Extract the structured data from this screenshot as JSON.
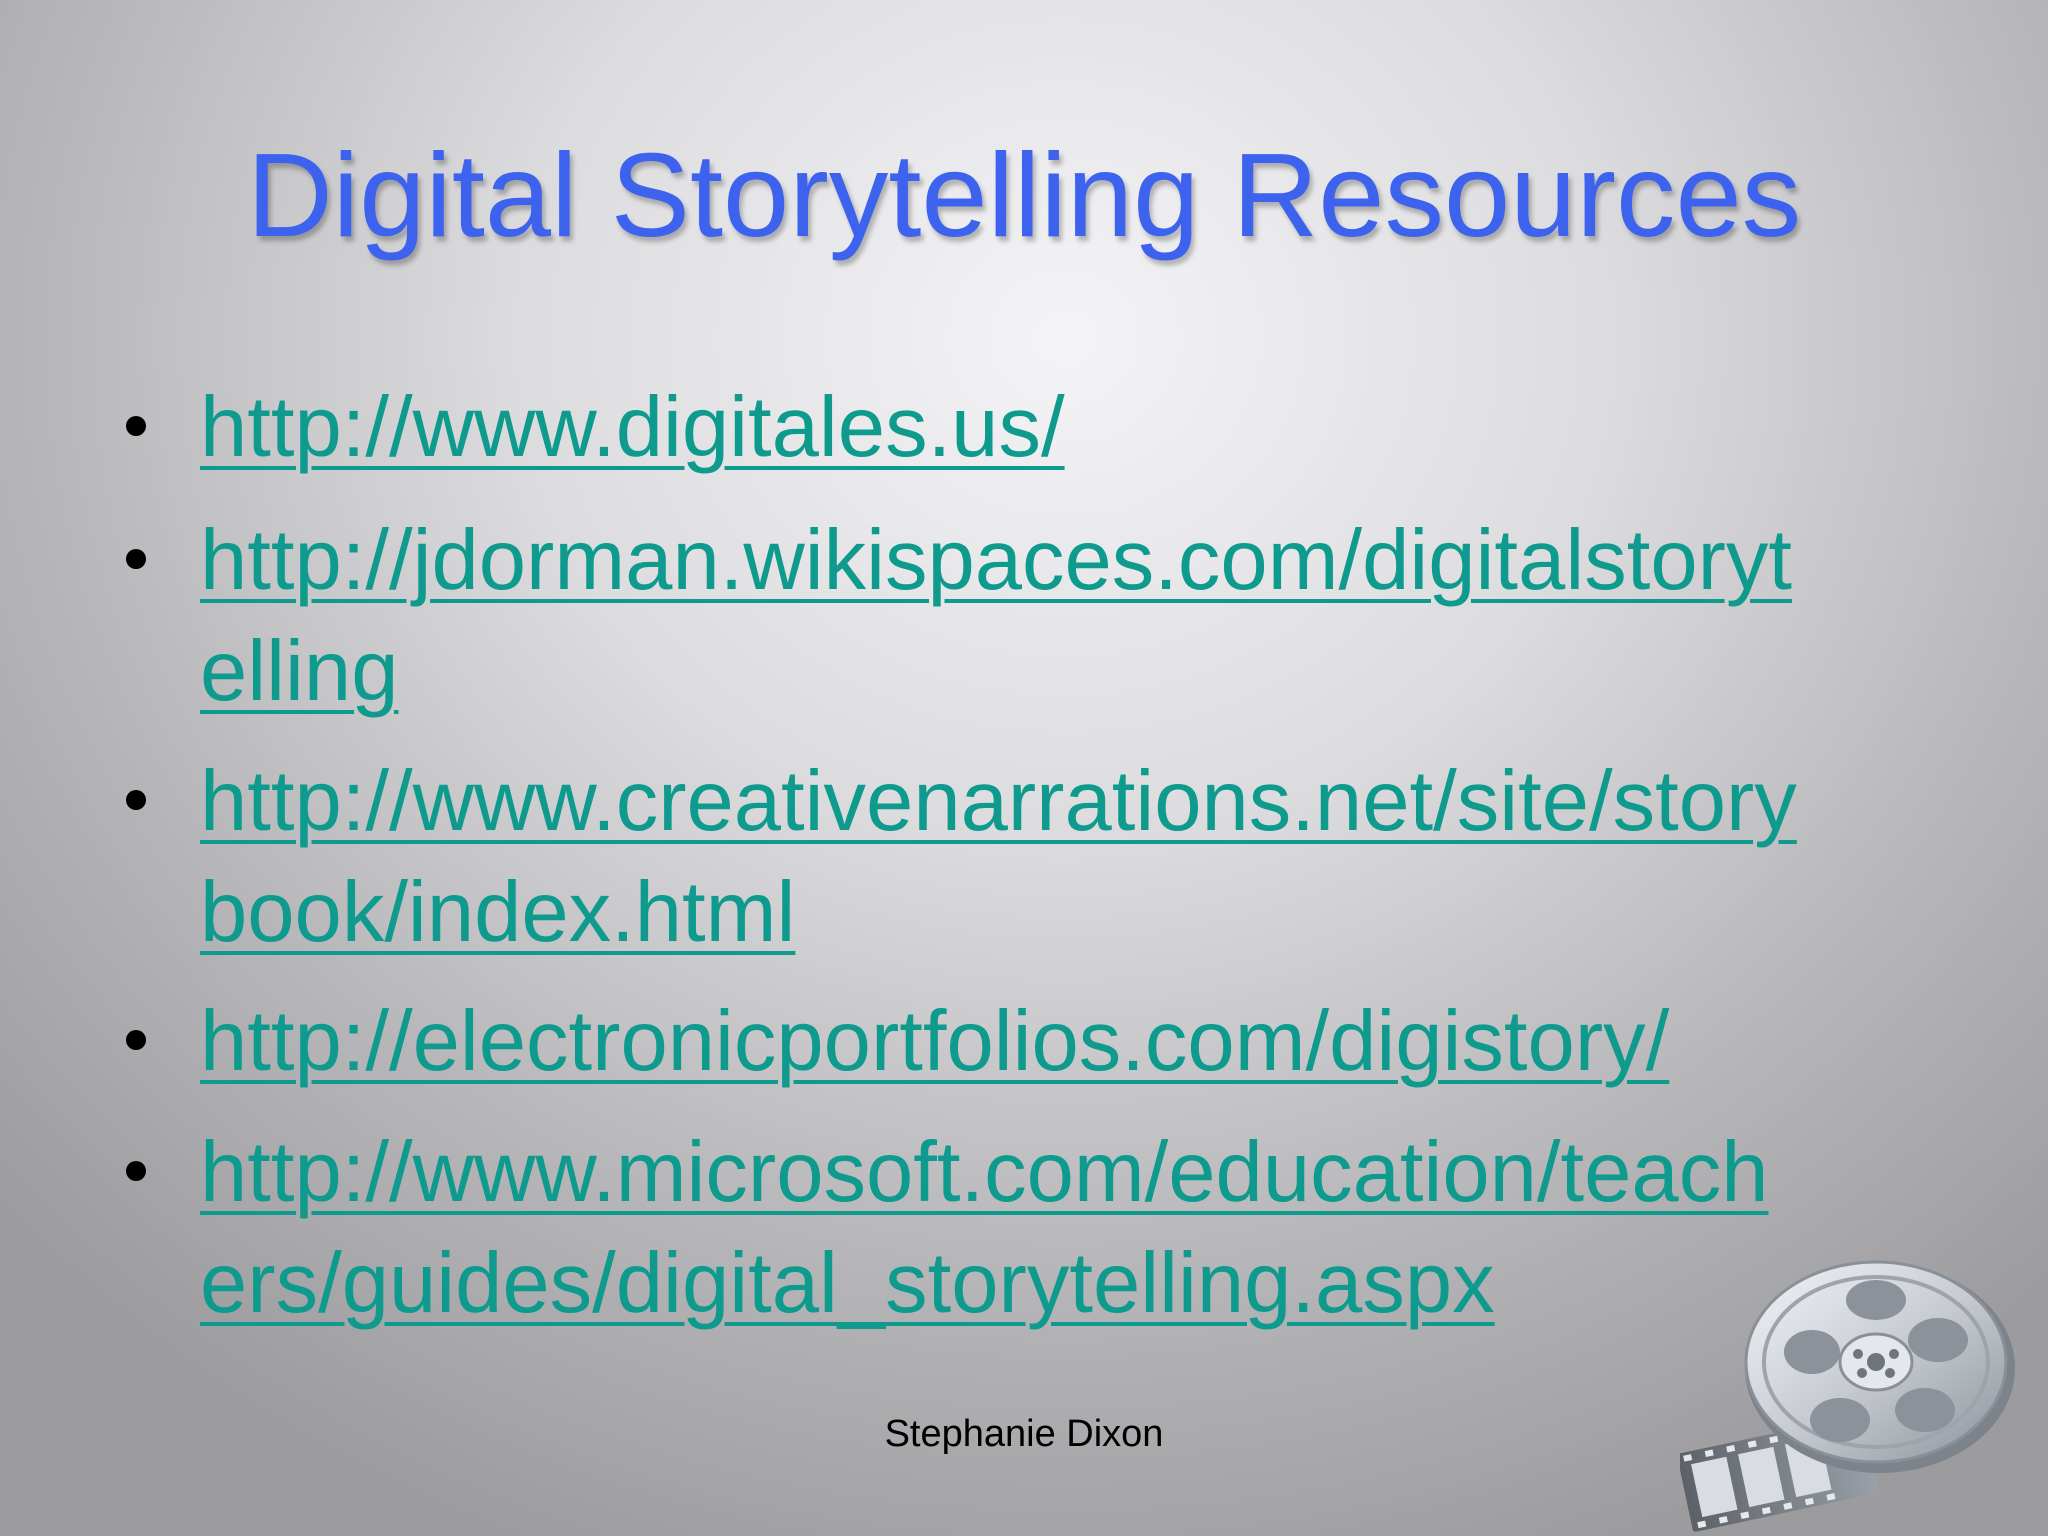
{
  "slide": {
    "title": "Digital Storytelling Resources",
    "links": [
      {
        "line1": "http://www.digitales.us/",
        "line2": ""
      },
      {
        "line1": "http://jdorman.wikispaces.com/digitalstoryt",
        "line2": "elling"
      },
      {
        "line1": "http://www.creativenarrations.net/site/story",
        "line2": "book/index.html"
      },
      {
        "line1": "http://electronicportfolios.com/digistory/",
        "line2": ""
      },
      {
        "line1": "http://www.microsoft.com/education/teach",
        "line2": "ers/guides/digital_storytelling.aspx"
      }
    ],
    "footer": "Stephanie Dixon",
    "decoration_icon": "film-reel-icon"
  },
  "colors": {
    "title": "#3d63ee",
    "link": "#0f9a8e",
    "background": "#dcdcde"
  }
}
